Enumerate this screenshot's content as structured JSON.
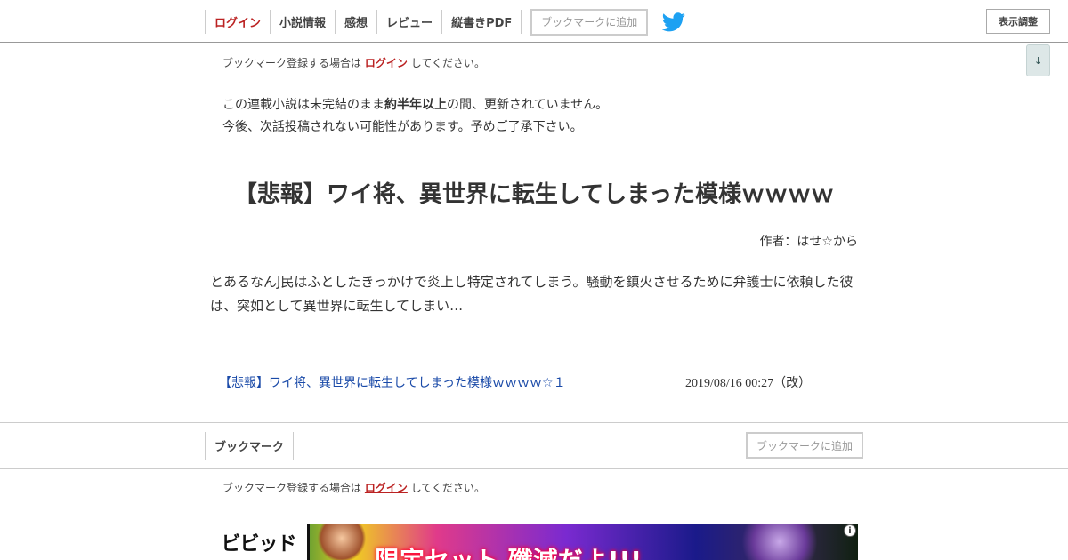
{
  "nav": {
    "login": "ログイン",
    "novel_info": "小説情報",
    "impressions": "感想",
    "review": "レビュー",
    "vertical_pdf": "縦書きPDF",
    "add_bookmark": "ブックマークに追加",
    "display_settings": "表示調整",
    "scroll_down": "↓"
  },
  "login_note": {
    "prefix": "ブックマーク登録する場合は",
    "link": "ログイン",
    "suffix": "してください。"
  },
  "warning": {
    "line1_pre": "この連載小説は未完結のまま",
    "line1_bold": "約半年以上",
    "line1_post": "の間、更新されていません。",
    "line2": "今後、次話投稿されない可能性があります。予めご了承下さい。"
  },
  "novel": {
    "title": "【悲報】ワイ将、異世界に転生してしまった模様ｗｗｗｗ",
    "author": "作者：はせ☆から",
    "synopsis": "とあるなんJ民はふとしたきっかけで炎上し特定されてしまう。騒動を鎮火させるために弁護士に依頼した彼は、突如として異世界に転生してしまい…"
  },
  "chapters": [
    {
      "title": "【悲報】ワイ将、異世界に転生してしまった模様ｗｗｗｗ☆１",
      "date": "2019/08/16 00:27",
      "revised_open": "（",
      "revised": "改",
      "revised_close": "）"
    }
  ],
  "bottom_nav": {
    "bookmark": "ブックマーク",
    "add_bookmark": "ブックマークに追加"
  },
  "ad": {
    "logo": "ビビッド",
    "headline": "限定セット 殲滅だよ!!!",
    "info": "i"
  },
  "colors": {
    "login_red": "#bb2222",
    "link_blue": "#1a4aa8",
    "twitter_blue": "#1da1f2"
  },
  "icons": {
    "twitter": "twitter-bird-icon",
    "ad_info": "info-icon"
  }
}
